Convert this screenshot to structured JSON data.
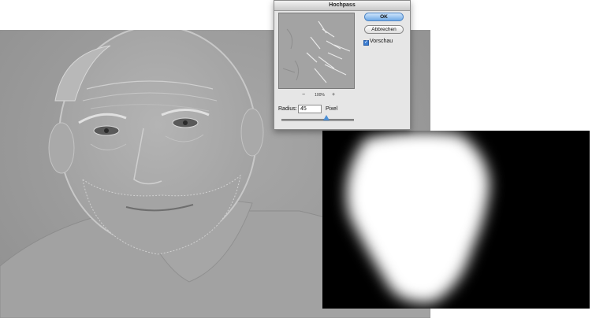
{
  "dialog": {
    "title": "Hochpass",
    "ok_label": "OK",
    "cancel_label": "Abbrechen",
    "preview_label": "Vorschau",
    "preview_checked": true,
    "zoom_value": "100%",
    "zoom_minus": "−",
    "zoom_plus": "+",
    "radius_label": "Radius:",
    "radius_value": "45",
    "radius_unit": "Pixel",
    "radius_slider_fraction": 0.62
  },
  "colors": {
    "accent": "#4d8fd4",
    "photo_gray": "#9e9e9e",
    "mask_white": "#ffffff",
    "mask_black": "#000000"
  }
}
